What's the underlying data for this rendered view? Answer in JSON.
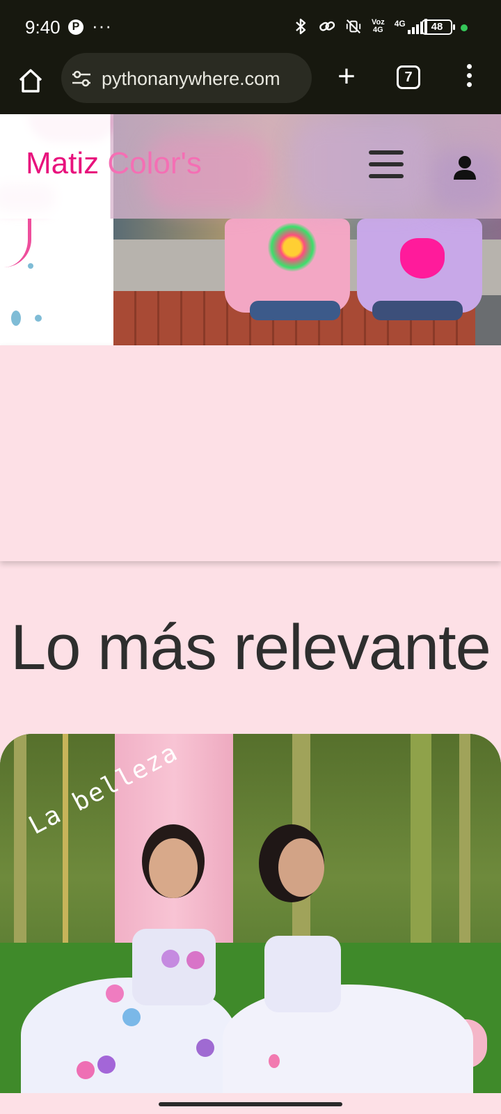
{
  "status_bar": {
    "time": "9:40",
    "pinterest_glyph": "P",
    "overflow_dots": "···",
    "network_label_top": "Voz",
    "network_label_bottom": "4G",
    "lte_label": "4G",
    "battery_level": "48",
    "icons": [
      "pinterest-icon",
      "bluetooth-icon",
      "link-icon",
      "vibrate-off-icon",
      "signal-icon",
      "battery-icon"
    ]
  },
  "browser": {
    "url": "pythonanywhere.com",
    "tab_count": "7",
    "new_tab_glyph": "+",
    "icons": [
      "home-icon",
      "site-settings-icon",
      "plus-icon",
      "tabs-icon",
      "more-vert-icon"
    ]
  },
  "header": {
    "brand_word1": "Matiz",
    "brand_word2": "Color's",
    "brand_color1": "#e8127d",
    "brand_color2": "#f46fb4",
    "icons": [
      "hamburger-menu-icon",
      "user-account-icon"
    ]
  },
  "main": {
    "section_title": "Lo más relevante",
    "feature_overlay_text": "La belleza"
  },
  "colors": {
    "page_background": "#fde0e6",
    "system_bar": "#17180f",
    "title_text": "#2e2e2e"
  }
}
